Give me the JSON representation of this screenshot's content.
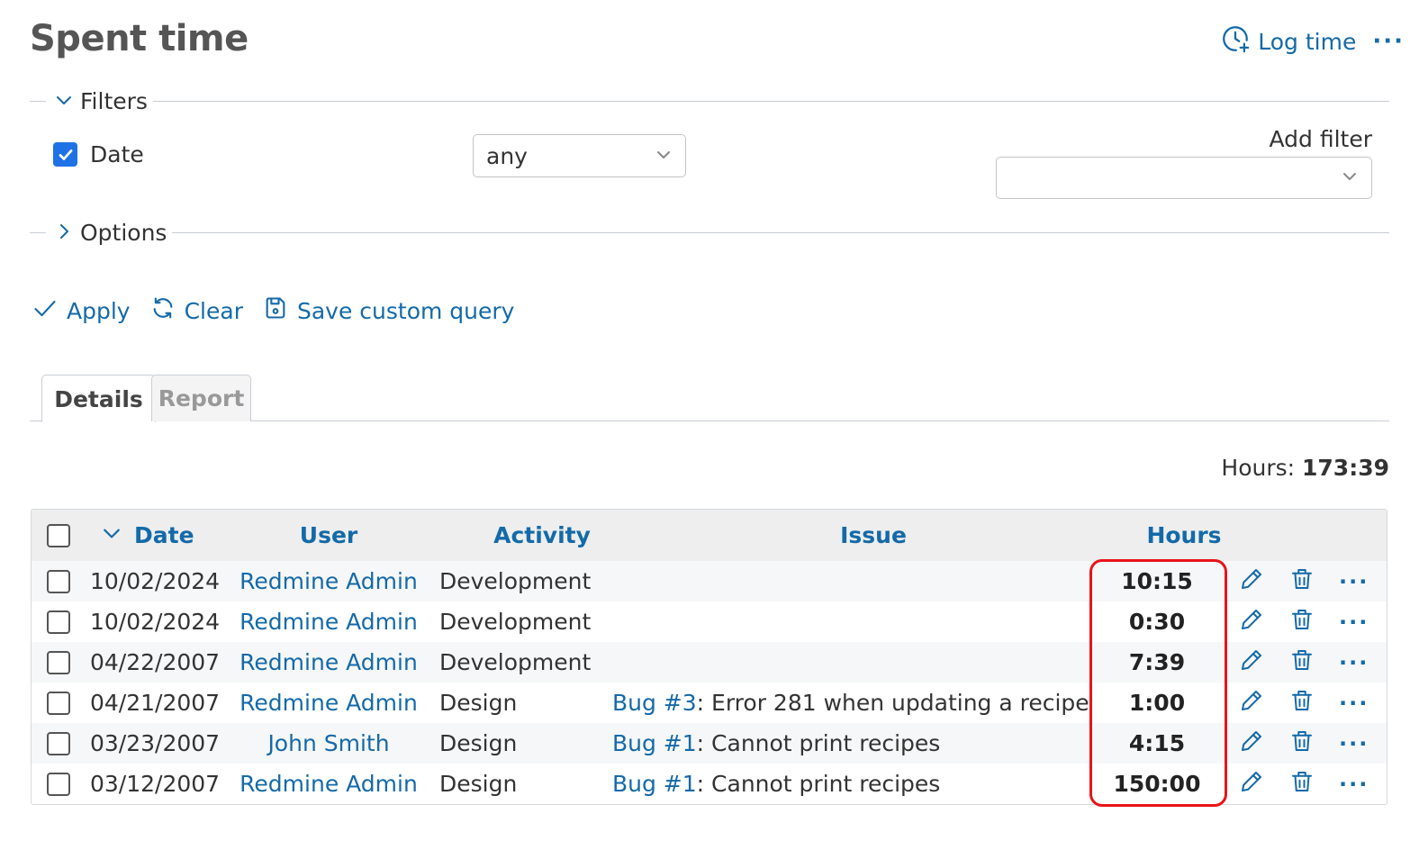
{
  "page": {
    "title": "Spent time"
  },
  "top_actions": {
    "log_time": "Log time",
    "more": "···"
  },
  "filters": {
    "legend": "Filters",
    "date": {
      "label": "Date",
      "checked": true,
      "operator": "any"
    },
    "add_filter": {
      "label": "Add filter",
      "value": ""
    }
  },
  "options": {
    "legend": "Options"
  },
  "query_actions": {
    "apply": "Apply",
    "clear": "Clear",
    "save": "Save custom query"
  },
  "tabs": [
    {
      "label": "Details",
      "active": true
    },
    {
      "label": "Report",
      "active": false
    }
  ],
  "totals": {
    "label": "Hours:",
    "value": "173:39"
  },
  "table": {
    "columns": {
      "date": "Date",
      "user": "User",
      "activity": "Activity",
      "issue": "Issue",
      "hours": "Hours"
    },
    "rows": [
      {
        "date": "10/02/2024",
        "user": "Redmine Admin",
        "activity": "Development",
        "issue_link": "",
        "issue_text": "",
        "hours": "10:15"
      },
      {
        "date": "10/02/2024",
        "user": "Redmine Admin",
        "activity": "Development",
        "issue_link": "",
        "issue_text": "",
        "hours": "0:30"
      },
      {
        "date": "04/22/2007",
        "user": "Redmine Admin",
        "activity": "Development",
        "issue_link": "",
        "issue_text": "",
        "hours": "7:39"
      },
      {
        "date": "04/21/2007",
        "user": "Redmine Admin",
        "activity": "Design",
        "issue_link": "Bug #3",
        "issue_text": ": Error 281 when updating a recipe",
        "hours": "1:00"
      },
      {
        "date": "03/23/2007",
        "user": "John Smith",
        "activity": "Design",
        "issue_link": "Bug #1",
        "issue_text": ": Cannot print recipes",
        "hours": "4:15"
      },
      {
        "date": "03/12/2007",
        "user": "Redmine Admin",
        "activity": "Design",
        "issue_link": "Bug #1",
        "issue_text": ": Cannot print recipes",
        "hours": "150:00"
      }
    ],
    "row_more": "···"
  },
  "colors": {
    "link": "#146aa8",
    "checkbox": "#1f72e6",
    "highlight": "#e8141a"
  }
}
